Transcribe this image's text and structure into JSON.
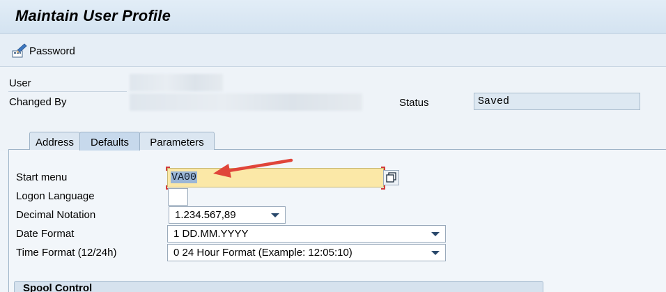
{
  "window": {
    "title": "Maintain User Profile"
  },
  "toolbar": {
    "password_label": "Password"
  },
  "header": {
    "user_label": "User",
    "changed_by_label": "Changed By",
    "status_label": "Status",
    "status_value": "Saved"
  },
  "tabs": [
    {
      "label": "Address",
      "active": false
    },
    {
      "label": "Defaults",
      "active": true
    },
    {
      "label": "Parameters",
      "active": false
    }
  ],
  "defaults": {
    "start_menu_label": "Start menu",
    "start_menu_value": "VA00",
    "logon_language_label": "Logon Language",
    "logon_language_value": "",
    "decimal_notation_label": "Decimal Notation",
    "decimal_notation_value": "1.234.567,89",
    "date_format_label": "Date Format",
    "date_format_value": "1 DD.MM.YYYY",
    "time_format_label": "Time Format (12/24h)",
    "time_format_value": "0 24 Hour Format (Example: 12:05:10)"
  },
  "spool": {
    "title": "Spool Control"
  },
  "colors": {
    "required_field": "#fbe8a7",
    "annotation_arrow": "#e0453a",
    "selection": "#9bb6d6"
  },
  "icons": {
    "password": "password-pen-icon",
    "f4_help": "value-help-icon",
    "dropdown": "chevron-down-icon"
  }
}
